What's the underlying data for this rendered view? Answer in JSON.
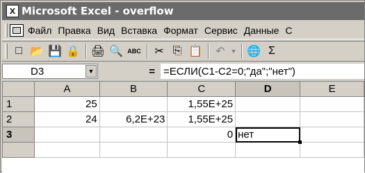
{
  "titlebar": {
    "app_icon": "excel-icon",
    "title": "Microsoft Excel - overflow"
  },
  "menu": {
    "items": [
      {
        "label": "Файл"
      },
      {
        "label": "Правка"
      },
      {
        "label": "Вид"
      },
      {
        "label": "Вставка"
      },
      {
        "label": "Формат"
      },
      {
        "label": "Сервис"
      },
      {
        "label": "Данные"
      },
      {
        "label": "С"
      }
    ]
  },
  "toolbar": {
    "new": "□",
    "open": "📂",
    "save": "💾",
    "permissions": "🔒",
    "print": "🖨",
    "preview": "🔍",
    "spelling": "ABC",
    "cut": "✂",
    "copy": "⎘",
    "paste": "📋",
    "undo": "↶",
    "hyperlink": "🌐",
    "autosum": "Σ"
  },
  "formula_bar": {
    "name_box": "D3",
    "equals": "=",
    "formula": "=ЕСЛИ(C1-C2=0;\"да\";\"нет\")"
  },
  "grid": {
    "columns": [
      "A",
      "B",
      "C",
      "D",
      "E"
    ],
    "active_column": "D",
    "rows": [
      {
        "num": "1",
        "cells": [
          "25",
          "",
          "1,55E+25",
          "",
          ""
        ]
      },
      {
        "num": "2",
        "cells": [
          "24",
          "6,2E+23",
          "1,55E+25",
          "",
          ""
        ]
      },
      {
        "num": "3",
        "cells": [
          "",
          "",
          "0",
          "нет",
          ""
        ]
      }
    ],
    "active_row": "3",
    "selected_cell": "D3"
  }
}
